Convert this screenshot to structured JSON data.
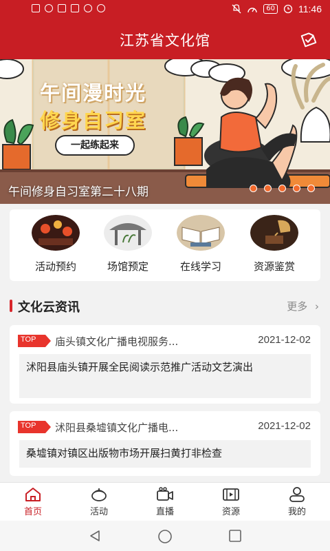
{
  "status_bar": {
    "time": "11:46",
    "battery": "60"
  },
  "header": {
    "title": "江苏省文化馆"
  },
  "banner": {
    "headline1": "午间漫时光",
    "headline2": "修身自习室",
    "button_label": "一起练起来",
    "caption": "午间修身自习室第二十八期",
    "slide_count": 5
  },
  "quick_menu": [
    {
      "label": "活动预约",
      "icon": "lantern-street-thumb"
    },
    {
      "label": "场馆预定",
      "icon": "pavilion-thumb"
    },
    {
      "label": "在线学习",
      "icon": "open-book-thumb"
    },
    {
      "label": "资源鉴赏",
      "icon": "gramophone-thumb"
    }
  ],
  "news_section": {
    "title": "文化云资讯",
    "more_label": "更多",
    "items": [
      {
        "tag": "TOP",
        "source": "庙头镇文化广播电视服务...",
        "date": "2021-12-02",
        "headline": "沭阳县庙头镇开展全民阅读示范推广活动文艺演出"
      },
      {
        "tag": "TOP",
        "source": "沭阳县桑墟镇文化广播电...",
        "date": "2021-12-02",
        "headline": "桑墟镇对镇区出版物市场开展扫黄打非检查"
      }
    ]
  },
  "tabbar": [
    {
      "label": "首页",
      "icon": "home-icon",
      "active": true
    },
    {
      "label": "活动",
      "icon": "activity-icon",
      "active": false
    },
    {
      "label": "直播",
      "icon": "live-camera-icon",
      "active": false
    },
    {
      "label": "资源",
      "icon": "film-icon",
      "active": false
    },
    {
      "label": "我的",
      "icon": "user-icon",
      "active": false
    }
  ],
  "colors": {
    "brand_red": "#c81e24",
    "accent_orange": "#f26a2d",
    "banner_bg": "#f3ecdd"
  }
}
